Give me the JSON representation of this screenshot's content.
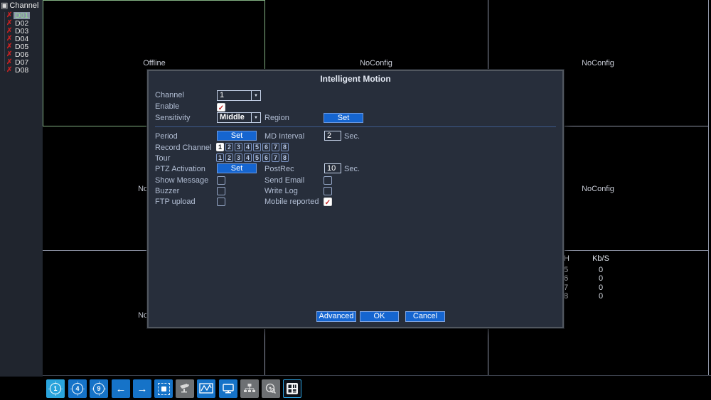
{
  "sidebar": {
    "header": "Channel",
    "items": [
      {
        "label": "D01",
        "selected": true
      },
      {
        "label": "D02",
        "selected": false
      },
      {
        "label": "D03",
        "selected": false
      },
      {
        "label": "D04",
        "selected": false
      },
      {
        "label": "D05",
        "selected": false
      },
      {
        "label": "D06",
        "selected": false
      },
      {
        "label": "D07",
        "selected": false
      },
      {
        "label": "D08",
        "selected": false
      }
    ]
  },
  "grid": {
    "cells": [
      {
        "pos": "row1-col1",
        "label": "Offline",
        "selected": true
      },
      {
        "pos": "row1-col2",
        "label": "NoConfig"
      },
      {
        "pos": "row1-col3",
        "label": "NoConfig"
      },
      {
        "pos": "row2-col1",
        "label": "NoConfig"
      },
      {
        "pos": "row2-col3",
        "label": "NoConfig"
      },
      {
        "pos": "row3-col1",
        "label": "NoConfig"
      }
    ]
  },
  "bitrate": {
    "col_ch": "H",
    "col_rate": "Kb/S",
    "rows": [
      {
        "ch": "5",
        "rate": "0"
      },
      {
        "ch": "6",
        "rate": "0"
      },
      {
        "ch": "7",
        "rate": "0"
      },
      {
        "ch": "8",
        "rate": "0"
      }
    ]
  },
  "dialog": {
    "title": "Intelligent Motion",
    "channel_label": "Channel",
    "channel_value": "1",
    "enable_label": "Enable",
    "enable_checked": true,
    "sensitivity_label": "Sensitivity",
    "sensitivity_value": "Middle",
    "region_label": "Region",
    "region_button": "Set",
    "period_label": "Period",
    "period_button": "Set",
    "md_label": "MD Interval",
    "md_value": "2",
    "md_unit": "Sec.",
    "record_label": "Record Channel",
    "tour_label": "Tour",
    "digits": [
      "1",
      "2",
      "3",
      "4",
      "5",
      "6",
      "7",
      "8"
    ],
    "record_selected": [
      "1"
    ],
    "tour_selected": [],
    "ptz_label": "PTZ Activation",
    "ptz_button": "Set",
    "postrec_label": "PostRec",
    "postrec_value": "10",
    "postrec_unit": "Sec.",
    "show_message_label": "Show Message",
    "show_message_checked": false,
    "send_email_label": "Send Email",
    "send_email_checked": false,
    "buzzer_label": "Buzzer",
    "buzzer_checked": false,
    "write_log_label": "Write Log",
    "write_log_checked": false,
    "ftp_label": "FTP upload",
    "ftp_checked": false,
    "mobile_label": "Mobile reported",
    "mobile_checked": true,
    "advanced_button": "Advanced",
    "ok_button": "OK",
    "cancel_button": "Cancel"
  },
  "toolbar": {
    "icons": [
      {
        "name": "view-single",
        "glyph": "1",
        "state": "active"
      },
      {
        "name": "view-quad",
        "glyph": "4",
        "state": "normal"
      },
      {
        "name": "view-nine",
        "glyph": "9",
        "state": "normal"
      },
      {
        "name": "prev-channel",
        "glyph": "←",
        "state": "normal"
      },
      {
        "name": "next-channel",
        "glyph": "→",
        "state": "normal"
      },
      {
        "name": "single-tour",
        "state": "normal"
      },
      {
        "name": "ptz-camera",
        "state": "disabled"
      },
      {
        "name": "bitrate-chart",
        "state": "normal"
      },
      {
        "name": "display-output",
        "state": "normal"
      },
      {
        "name": "network-status",
        "state": "disabled"
      },
      {
        "name": "record-search",
        "state": "disabled"
      },
      {
        "name": "channel-matrix",
        "state": "normal"
      }
    ]
  },
  "colors": {
    "accent_blue": "#1565d0",
    "toolbar_blue": "#1673c8",
    "toolbar_active_blue": "#2aa4dc",
    "toolbar_gray": "#6d7073",
    "selected_cell_green": "#83b183",
    "alert_red": "#c92222",
    "dialog_bg": "#272e3b"
  }
}
